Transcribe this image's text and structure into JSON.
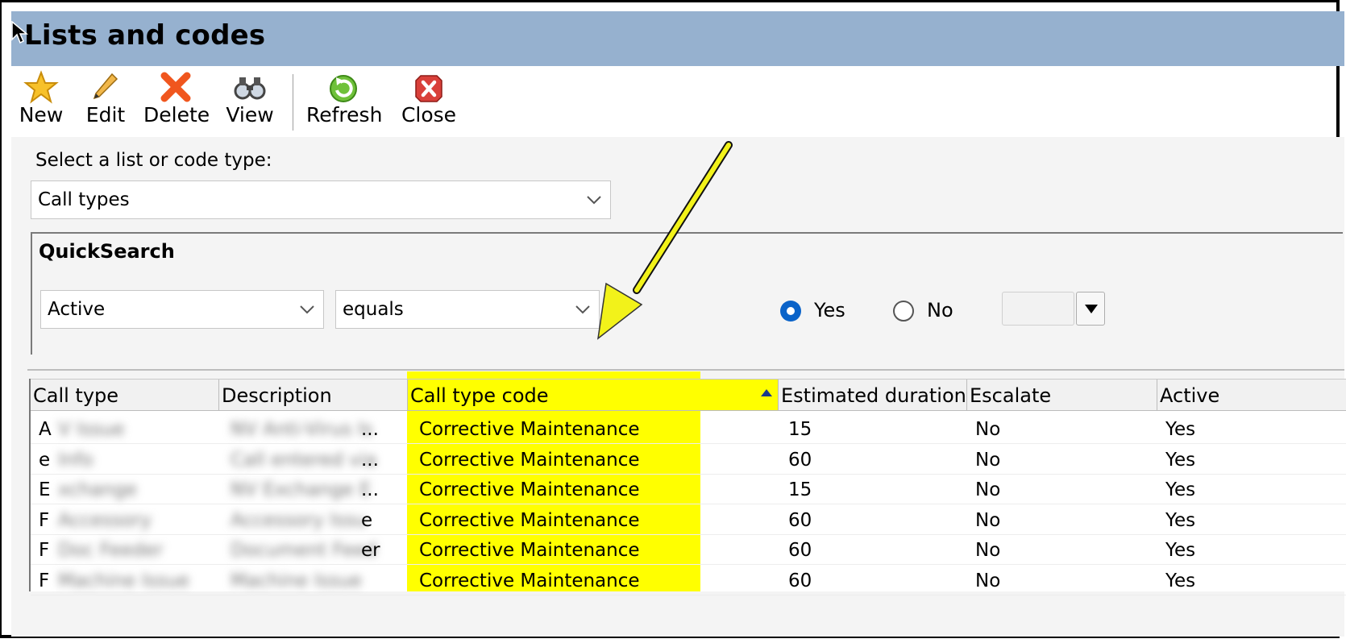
{
  "window": {
    "title": "Lists and codes"
  },
  "toolbar": {
    "buttons": [
      {
        "label": "New",
        "icon": "star-icon"
      },
      {
        "label": "Edit",
        "icon": "pencil-icon"
      },
      {
        "label": "Delete",
        "icon": "red-x-icon"
      },
      {
        "label": "View",
        "icon": "binoculars-icon"
      },
      {
        "label": "Refresh",
        "icon": "refresh-icon"
      },
      {
        "label": "Close",
        "icon": "close-icon"
      }
    ]
  },
  "list_select": {
    "label": "Select a list or code type:",
    "value": "Call types"
  },
  "quicksearch": {
    "title": "QuickSearch",
    "field": "Active",
    "operator": "equals",
    "options": [
      "Yes",
      "No"
    ],
    "selected": "Yes"
  },
  "grid": {
    "columns": [
      "Call type",
      "Description",
      "Call type code",
      "Estimated duration",
      "Escalate",
      "Active"
    ],
    "sorted_column": "Call type code",
    "rows": [
      {
        "call_type": "A",
        "call_type_blurred": "V Issue",
        "description_blurred": "NV Anti-Virus Is",
        "description_tail": "...",
        "code": "Corrective Maintenance",
        "duration": "15",
        "escalate": "No",
        "active": "Yes"
      },
      {
        "call_type": "e",
        "call_type_blurred": "Info",
        "description_blurred": "Call entered via",
        "description_tail": "...",
        "code": "Corrective Maintenance",
        "duration": "60",
        "escalate": "No",
        "active": "Yes"
      },
      {
        "call_type": "E",
        "call_type_blurred": "xchange",
        "description_blurred": "NV Exchange E",
        "description_tail": "...",
        "code": "Corrective Maintenance",
        "duration": "15",
        "escalate": "No",
        "active": "Yes"
      },
      {
        "call_type": "F",
        "call_type_blurred": "Accessory",
        "description_blurred": "Accessory Issu",
        "description_tail": "e",
        "code": "Corrective Maintenance",
        "duration": "60",
        "escalate": "No",
        "active": "Yes"
      },
      {
        "call_type": "F",
        "call_type_blurred": "Doc Feeder",
        "description_blurred": "Document Feed",
        "description_tail": "er",
        "code": "Corrective Maintenance",
        "duration": "60",
        "escalate": "No",
        "active": "Yes"
      },
      {
        "call_type": "F",
        "call_type_blurred": "Machine Issue",
        "description_blurred": "Machine Issue",
        "description_tail": "",
        "code": "Corrective Maintenance",
        "duration": "60",
        "escalate": "No",
        "active": "Yes"
      }
    ]
  },
  "colors": {
    "titlebar": "#96b1cf",
    "highlight": "#ffff00",
    "arrow": "#f2f21a",
    "radio_selected": "#0a63c9"
  }
}
